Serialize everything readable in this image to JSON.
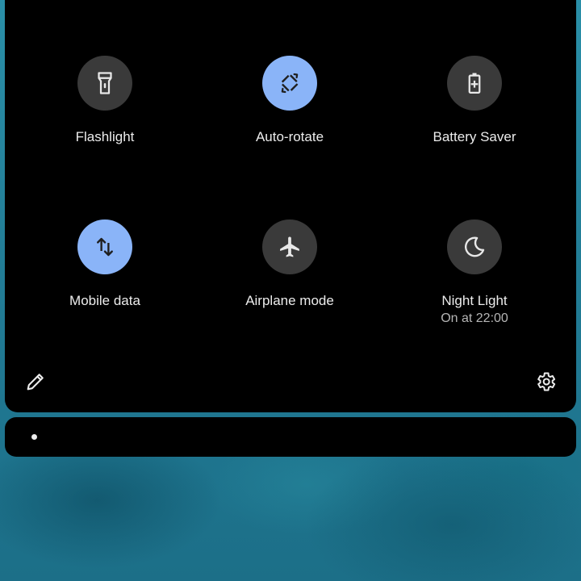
{
  "quick_settings": {
    "tiles": [
      {
        "label": "Flashlight",
        "subtitle": "",
        "active": false,
        "icon": "flashlight-icon"
      },
      {
        "label": "Auto-rotate",
        "subtitle": "",
        "active": true,
        "icon": "auto-rotate-icon"
      },
      {
        "label": "Battery Saver",
        "subtitle": "",
        "active": false,
        "icon": "battery-saver-icon"
      },
      {
        "label": "Mobile data",
        "subtitle": "",
        "active": true,
        "icon": "mobile-data-icon"
      },
      {
        "label": "Airplane mode",
        "subtitle": "",
        "active": false,
        "icon": "airplane-icon"
      },
      {
        "label": "Night Light",
        "subtitle": "On at 22:00",
        "active": false,
        "icon": "moon-icon"
      }
    ],
    "edit_icon": "pencil-icon",
    "settings_icon": "gear-icon"
  },
  "colors": {
    "panel_bg": "#000000",
    "tile_active": "#8ab4f8",
    "tile_inactive": "#3a3a3a",
    "icon_on_active": "#1f1f1f",
    "icon_on_inactive": "#e8e8e8",
    "wallpaper": "#237f98"
  },
  "notification": {
    "indicator": "notification-dot"
  }
}
